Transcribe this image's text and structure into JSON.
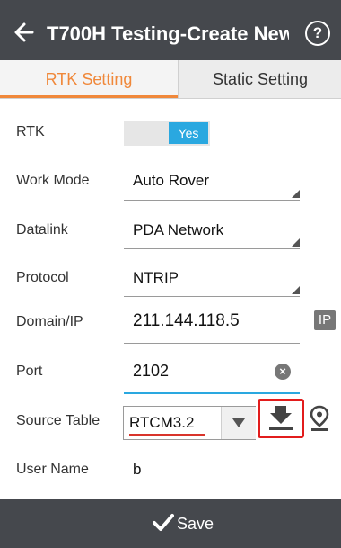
{
  "header": {
    "title": "T700H Testing-Create New",
    "back_icon": "back-arrow-icon",
    "help_icon": "help-circle-icon",
    "help_glyph": "?"
  },
  "tabs": [
    {
      "label": "RTK Setting",
      "active": true
    },
    {
      "label": "Static Setting",
      "active": false
    }
  ],
  "form": {
    "rtk": {
      "label": "RTK",
      "toggle_value": "Yes"
    },
    "work_mode": {
      "label": "Work Mode",
      "value": "Auto Rover"
    },
    "datalink": {
      "label": "Datalink",
      "value": "PDA Network"
    },
    "protocol": {
      "label": "Protocol",
      "value": "NTRIP"
    },
    "domain_ip": {
      "label": "Domain/IP",
      "value": "211.144.118.5",
      "badge": "IP"
    },
    "port": {
      "label": "Port",
      "value": "2102",
      "clear_glyph": "×"
    },
    "source_table": {
      "label": "Source Table",
      "value": "RTCM3.2"
    },
    "user_name": {
      "label": "User Name",
      "value": "b"
    }
  },
  "footer": {
    "save_label": "Save"
  },
  "colors": {
    "header_bg": "#45484d",
    "accent_orange": "#f0883a",
    "toggle_blue": "#2aa8e0",
    "highlight_red": "#e21c1c"
  }
}
